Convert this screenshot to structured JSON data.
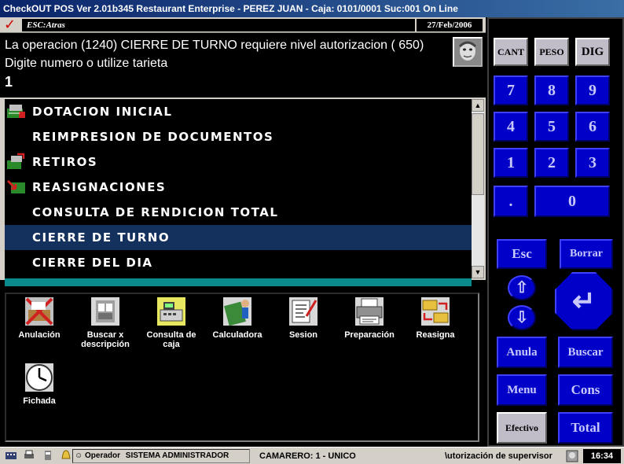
{
  "window": {
    "title": "CheckOUT POS Ver 2.01b345 Restaurant Enterprise - PEREZ JUAN - Caja: 0101/0001 Suc:001  On Line"
  },
  "topbar": {
    "esc_label": "ESC:Atras",
    "date": "27/Feb/2006"
  },
  "message": {
    "line1": "La operacion (1240) CIERRE DE TURNO requiere nivel autorizacion ( 650)",
    "line2": "Digite numero  o utilize tarieta",
    "input_value": "1"
  },
  "menu": {
    "items": [
      {
        "label": "DOTACION INICIAL",
        "icon": "cash-drawer-icon"
      },
      {
        "label": "REIMPRESION DE DOCUMENTOS",
        "icon": ""
      },
      {
        "label": "RETIROS",
        "icon": "withdrawal-icon"
      },
      {
        "label": "REASIGNACIONES",
        "icon": "reassign-icon"
      },
      {
        "label": "CONSULTA DE RENDICION TOTAL",
        "icon": ""
      },
      {
        "label": "CIERRE DE TURNO",
        "icon": "",
        "selected": true
      },
      {
        "label": "CIERRE DEL DIA",
        "icon": ""
      }
    ]
  },
  "launchers": [
    {
      "label": "Anulación",
      "icon": "void-icon"
    },
    {
      "label": "Buscar x descripción",
      "icon": "search-description-icon"
    },
    {
      "label": "Consulta de caja",
      "icon": "register-query-icon"
    },
    {
      "label": "Calculadora",
      "icon": "calculator-icon"
    },
    {
      "label": "Sesion",
      "icon": "session-icon"
    },
    {
      "label": "Preparación",
      "icon": "printer-icon"
    },
    {
      "label": "Reasigna",
      "icon": "folders-swap-icon"
    },
    {
      "label": "Fichada",
      "icon": "clock-icon"
    }
  ],
  "keypad": {
    "top": [
      "CANT",
      "PESO",
      "DIG"
    ],
    "digits": [
      "7",
      "8",
      "9",
      "4",
      "5",
      "6",
      "1",
      "2",
      "3"
    ],
    "dot": ".",
    "zero": "0",
    "esc": "Esc",
    "borrar": "Borrar",
    "up": "⇧",
    "down": "⇩",
    "enter": "↵",
    "anula": "Anula",
    "buscar": "Buscar",
    "menu": "Menu",
    "cons": "Cons",
    "efectivo": "Efectivo",
    "total": "Total"
  },
  "status": {
    "operator_label": "Operador",
    "operator_name": "SISTEMA ADMINISTRADOR",
    "camarero": "CAMARERO: 1 -  UNICO",
    "auth": "\\utorización de supervisor",
    "time": "16:34"
  },
  "colors": {
    "key_blue": "#0000c8",
    "selected_row": "#14305c",
    "teal_bar": "#0a8a8a"
  }
}
